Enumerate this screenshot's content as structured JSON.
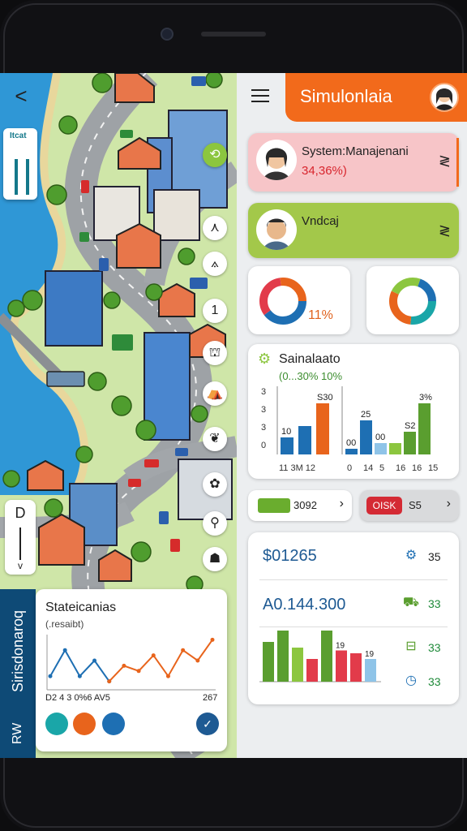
{
  "map": {
    "back_label": "<",
    "tag_text": "Itcat",
    "zoom_top": "D",
    "zoom_bottom": "v",
    "side_label_main": "Sirisdonaroq",
    "side_label_sub": "RW",
    "tools": [
      {
        "name": "leaf-icon",
        "glyph": "⟲"
      },
      {
        "name": "fork-icon",
        "glyph": "⋏"
      },
      {
        "name": "pin-icon",
        "glyph": "⟑"
      },
      {
        "name": "number-icon",
        "glyph": "1"
      },
      {
        "name": "basket-icon",
        "glyph": "⛫"
      },
      {
        "name": "tent-icon",
        "glyph": "⛺"
      },
      {
        "name": "heart-icon",
        "glyph": "❦"
      },
      {
        "name": "flower-icon",
        "glyph": "✿"
      },
      {
        "name": "walk-icon",
        "glyph": "⚲"
      },
      {
        "name": "group-icon",
        "glyph": "☗"
      }
    ],
    "stats": {
      "title": "Stateicanias",
      "subtitle": "(.resaibt)",
      "axis_left": "D2 4 3 0%6 AV5",
      "axis_right": "267",
      "dot_colors": [
        "#1aa6a8",
        "#e8641c",
        "#1e6fb3"
      ],
      "button_icon": "✓",
      "chart_data": {
        "type": "line",
        "x": [
          0,
          1,
          2,
          3,
          4,
          5,
          6,
          7,
          8,
          9,
          10,
          11
        ],
        "series": [
          {
            "color": "#1e6fb3",
            "values": [
              20,
              70,
              20,
              50,
              10
            ]
          },
          {
            "color": "#e8641c",
            "values": [
              null,
              null,
              null,
              null,
              10,
              40,
              30,
              60,
              20,
              70,
              50,
              90
            ]
          }
        ]
      }
    }
  },
  "dash": {
    "app_title": "Simulonlaia",
    "card1": {
      "title": "System:Manajenani",
      "value": "34,36%)"
    },
    "card2": {
      "title": "Vndcaj"
    },
    "donut1_pct": "11%",
    "bar_card": {
      "title": "Sainalaato",
      "subtitle": "(0...30% 10%",
      "chart_data": {
        "type": "bar",
        "groups": [
          {
            "y_ticks": [
              "3",
              "3",
              "3",
              "0"
            ],
            "x_labels": "11  3M 12",
            "bars": [
              {
                "value": 3,
                "label": "10",
                "color": "#1e6fb3"
              },
              {
                "value": 5,
                "label": "",
                "color": "#1e6fb3"
              },
              {
                "value": 9,
                "label": "S30",
                "color": "#e8641c"
              }
            ]
          },
          {
            "x_labels": [
              "0",
              "14",
              "5",
              "16",
              "16",
              "15"
            ],
            "bars": [
              {
                "value": 1,
                "label": "00",
                "color": "#1e6fb3"
              },
              {
                "value": 6,
                "label": "25",
                "color": "#1e6fb3"
              },
              {
                "value": 2,
                "label": "00",
                "color": "#8fc4e8"
              },
              {
                "value": 2,
                "label": "",
                "color": "#8cc63f"
              },
              {
                "value": 4,
                "label": "S2",
                "color": "#5a9e2f"
              },
              {
                "value": 9,
                "label": "3%",
                "color": "#5a9e2f"
              }
            ]
          }
        ]
      }
    },
    "pill_a": {
      "value": "3092",
      "swatch": "#6aad2e"
    },
    "pill_b": {
      "tag": "OISK",
      "value": "S5"
    },
    "finance": {
      "amount1": "$01265",
      "amount2": "A0.144.300",
      "rows": [
        {
          "icon": "gear-icon",
          "value": "35"
        },
        {
          "icon": "truck-icon",
          "value": "33"
        },
        {
          "icon": "register-icon",
          "value": "33"
        },
        {
          "icon": "clock-icon",
          "value": "33"
        }
      ],
      "chart_data": {
        "type": "bar",
        "bars": [
          {
            "value": 70,
            "color": "#5a9e2f",
            "label": ""
          },
          {
            "value": 90,
            "color": "#5a9e2f",
            "label": ""
          },
          {
            "value": 60,
            "color": "#8cc63f",
            "label": ""
          },
          {
            "value": 40,
            "color": "#e23b4a",
            "label": ""
          },
          {
            "value": 90,
            "color": "#5a9e2f",
            "label": ""
          },
          {
            "value": 55,
            "color": "#e23b4a",
            "label": "19"
          },
          {
            "value": 50,
            "color": "#e23b4a",
            "label": ""
          },
          {
            "value": 40,
            "color": "#8fc4e8",
            "label": "19"
          }
        ]
      }
    }
  }
}
